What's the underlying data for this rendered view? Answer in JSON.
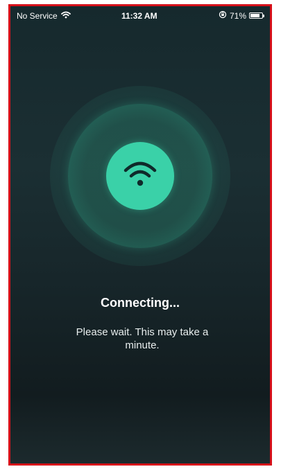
{
  "status_bar": {
    "carrier": "No Service",
    "time": "11:32 AM",
    "battery_percent": "71%",
    "battery_level": 0.71
  },
  "main": {
    "title": "Connecting...",
    "subtitle": "Please wait. This may take a minute."
  },
  "icons": {
    "status_wifi": "wifi-icon",
    "orientation_lock": "orientation-lock-icon",
    "battery": "battery-icon",
    "center": "wifi-icon"
  },
  "colors": {
    "accent": "#3ad1a8",
    "background": "#17262a",
    "border": "#d6101a"
  }
}
